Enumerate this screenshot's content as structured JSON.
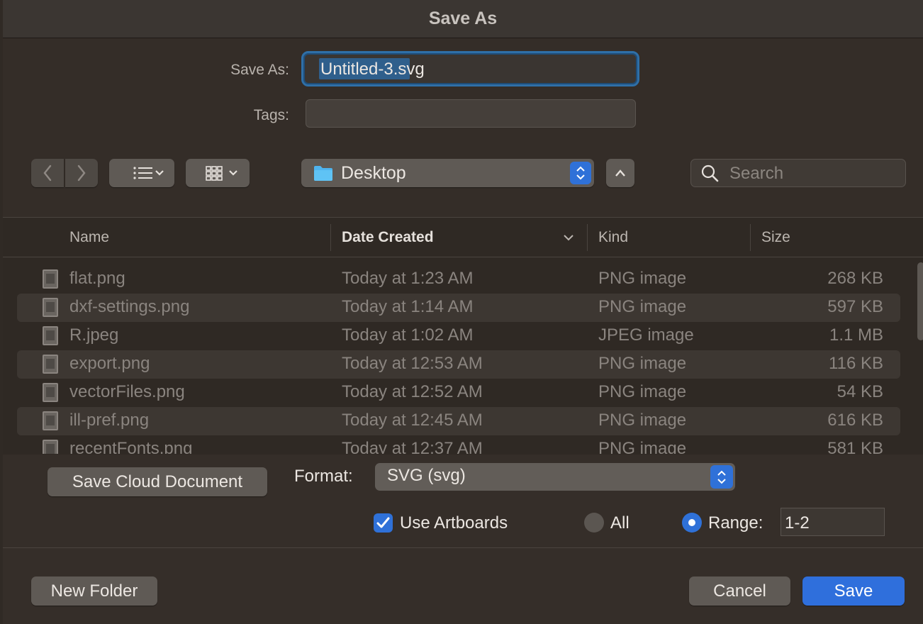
{
  "dialog": {
    "title": "Save As"
  },
  "save_as": {
    "label": "Save As:",
    "value": "Untitled-3.svg"
  },
  "tags": {
    "label": "Tags:",
    "value": ""
  },
  "toolbar": {
    "location": "Desktop",
    "search_placeholder": "Search"
  },
  "columns": {
    "name": "Name",
    "date": "Date Created",
    "kind": "Kind",
    "size": "Size"
  },
  "files": [
    {
      "name": "flat.png",
      "date": "Today at 1:23 AM",
      "kind": "PNG image",
      "size": "268 KB"
    },
    {
      "name": "dxf-settings.png",
      "date": "Today at 1:14 AM",
      "kind": "PNG image",
      "size": "597 KB"
    },
    {
      "name": "R.jpeg",
      "date": "Today at 1:02 AM",
      "kind": "JPEG image",
      "size": "1.1 MB"
    },
    {
      "name": "export.png",
      "date": "Today at 12:53 AM",
      "kind": "PNG image",
      "size": "116 KB"
    },
    {
      "name": "vectorFiles.png",
      "date": "Today at 12:52 AM",
      "kind": "PNG image",
      "size": "54 KB"
    },
    {
      "name": "ill-pref.png",
      "date": "Today at 12:45 AM",
      "kind": "PNG image",
      "size": "616 KB"
    },
    {
      "name": "recentFonts.png",
      "date": "Today at 12:37 AM",
      "kind": "PNG image",
      "size": "581 KB"
    }
  ],
  "options": {
    "cloud_button": "Save Cloud Document",
    "format_label": "Format:",
    "format_value": "SVG (svg)",
    "use_artboards": "Use Artboards",
    "all_label": "All",
    "range_label": "Range:",
    "range_value": "1-2"
  },
  "footer": {
    "new_folder": "New Folder",
    "cancel": "Cancel",
    "save": "Save"
  },
  "colors": {
    "accent": "#2f71d8"
  }
}
